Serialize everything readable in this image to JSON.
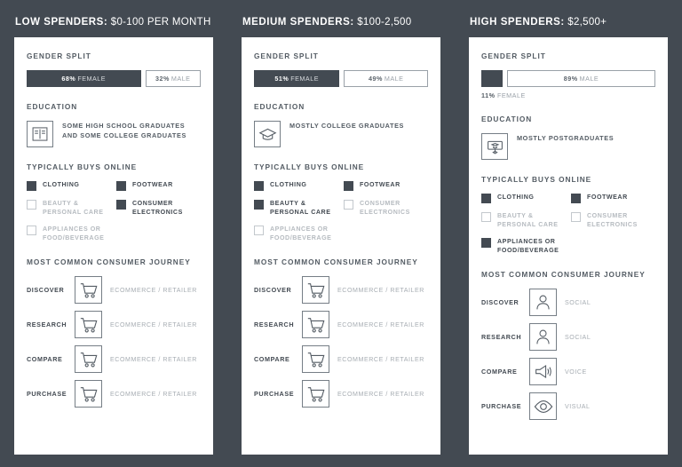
{
  "theme": {
    "background": "#434a52",
    "card_background": "#ffffff",
    "dark": "#434a52",
    "muted_text": "#a7adb3",
    "heading_text": "#545c64"
  },
  "sections": {
    "gender_split": "GENDER SPLIT",
    "education": "EDUCATION",
    "buys_online": "TYPICALLY BUYS ONLINE",
    "journey": "MOST COMMON CONSUMER JOURNEY"
  },
  "columns": [
    {
      "title_label": "LOW SPENDERS:",
      "title_amount": " $0-100 PER MONTH",
      "gender": {
        "female_pct": "68%",
        "female_label": "FEMALE",
        "male_pct": "32%",
        "male_label": "MALE",
        "female_weight": 68,
        "male_weight": 32,
        "layout": "inline"
      },
      "education": {
        "icon": "open-book-icon",
        "text": "SOME HIGH SCHOOL GRADUATES AND SOME COLLEGE GRADUATES"
      },
      "buys": [
        {
          "label": "CLOTHING",
          "checked": true
        },
        {
          "label": "FOOTWEAR",
          "checked": true
        },
        {
          "label": "BEAUTY & PERSONAL CARE",
          "checked": false
        },
        {
          "label": "CONSUMER ELECTRONICS",
          "checked": true
        },
        {
          "label": "APPLIANCES OR FOOD/BEVERAGE",
          "checked": false
        }
      ],
      "journey": [
        {
          "stage": "DISCOVER",
          "icon": "shopping-cart-icon",
          "label": "ECOMMERCE / RETAILER"
        },
        {
          "stage": "RESEARCH",
          "icon": "shopping-cart-icon",
          "label": "ECOMMERCE / RETAILER"
        },
        {
          "stage": "COMPARE",
          "icon": "shopping-cart-icon",
          "label": "ECOMMERCE / RETAILER"
        },
        {
          "stage": "PURCHASE",
          "icon": "shopping-cart-icon",
          "label": "ECOMMERCE / RETAILER"
        }
      ]
    },
    {
      "title_label": "MEDIUM SPENDERS:",
      "title_amount": " $100-2,500",
      "gender": {
        "female_pct": "51%",
        "female_label": "FEMALE",
        "male_pct": "49%",
        "male_label": "MALE",
        "female_weight": 51,
        "male_weight": 49,
        "layout": "inline"
      },
      "education": {
        "icon": "graduation-cap-icon",
        "text": "MOSTLY COLLEGE GRADUATES"
      },
      "buys": [
        {
          "label": "CLOTHING",
          "checked": true
        },
        {
          "label": "FOOTWEAR",
          "checked": true
        },
        {
          "label": "BEAUTY & PERSONAL CARE",
          "checked": true
        },
        {
          "label": "CONSUMER ELECTRONICS",
          "checked": false
        },
        {
          "label": "APPLIANCES OR FOOD/BEVERAGE",
          "checked": false
        }
      ],
      "journey": [
        {
          "stage": "DISCOVER",
          "icon": "shopping-cart-icon",
          "label": "ECOMMERCE / RETAILER"
        },
        {
          "stage": "RESEARCH",
          "icon": "shopping-cart-icon",
          "label": "ECOMMERCE / RETAILER"
        },
        {
          "stage": "COMPARE",
          "icon": "shopping-cart-icon",
          "label": "ECOMMERCE / RETAILER"
        },
        {
          "stage": "PURCHASE",
          "icon": "shopping-cart-icon",
          "label": "ECOMMERCE / RETAILER"
        }
      ]
    },
    {
      "title_label": "HIGH SPENDERS:",
      "title_amount": " $2,500+",
      "gender": {
        "female_pct": "11%",
        "female_label": "FEMALE",
        "male_pct": "89%",
        "male_label": "MALE",
        "female_weight": 11,
        "male_weight": 89,
        "layout": "below"
      },
      "education": {
        "icon": "diploma-icon",
        "text": "MOSTLY POSTGRADUATES"
      },
      "buys": [
        {
          "label": "CLOTHING",
          "checked": true
        },
        {
          "label": "FOOTWEAR",
          "checked": true
        },
        {
          "label": "BEAUTY & PERSONAL CARE",
          "checked": false
        },
        {
          "label": "CONSUMER ELECTRONICS",
          "checked": false
        },
        {
          "label": "APPLIANCES OR FOOD/BEVERAGE",
          "checked": true
        }
      ],
      "journey": [
        {
          "stage": "DISCOVER",
          "icon": "person-icon",
          "label": "SOCIAL"
        },
        {
          "stage": "RESEARCH",
          "icon": "person-icon",
          "label": "SOCIAL"
        },
        {
          "stage": "COMPARE",
          "icon": "megaphone-icon",
          "label": "VOICE"
        },
        {
          "stage": "PURCHASE",
          "icon": "eye-icon",
          "label": "VISUAL"
        }
      ]
    }
  ]
}
